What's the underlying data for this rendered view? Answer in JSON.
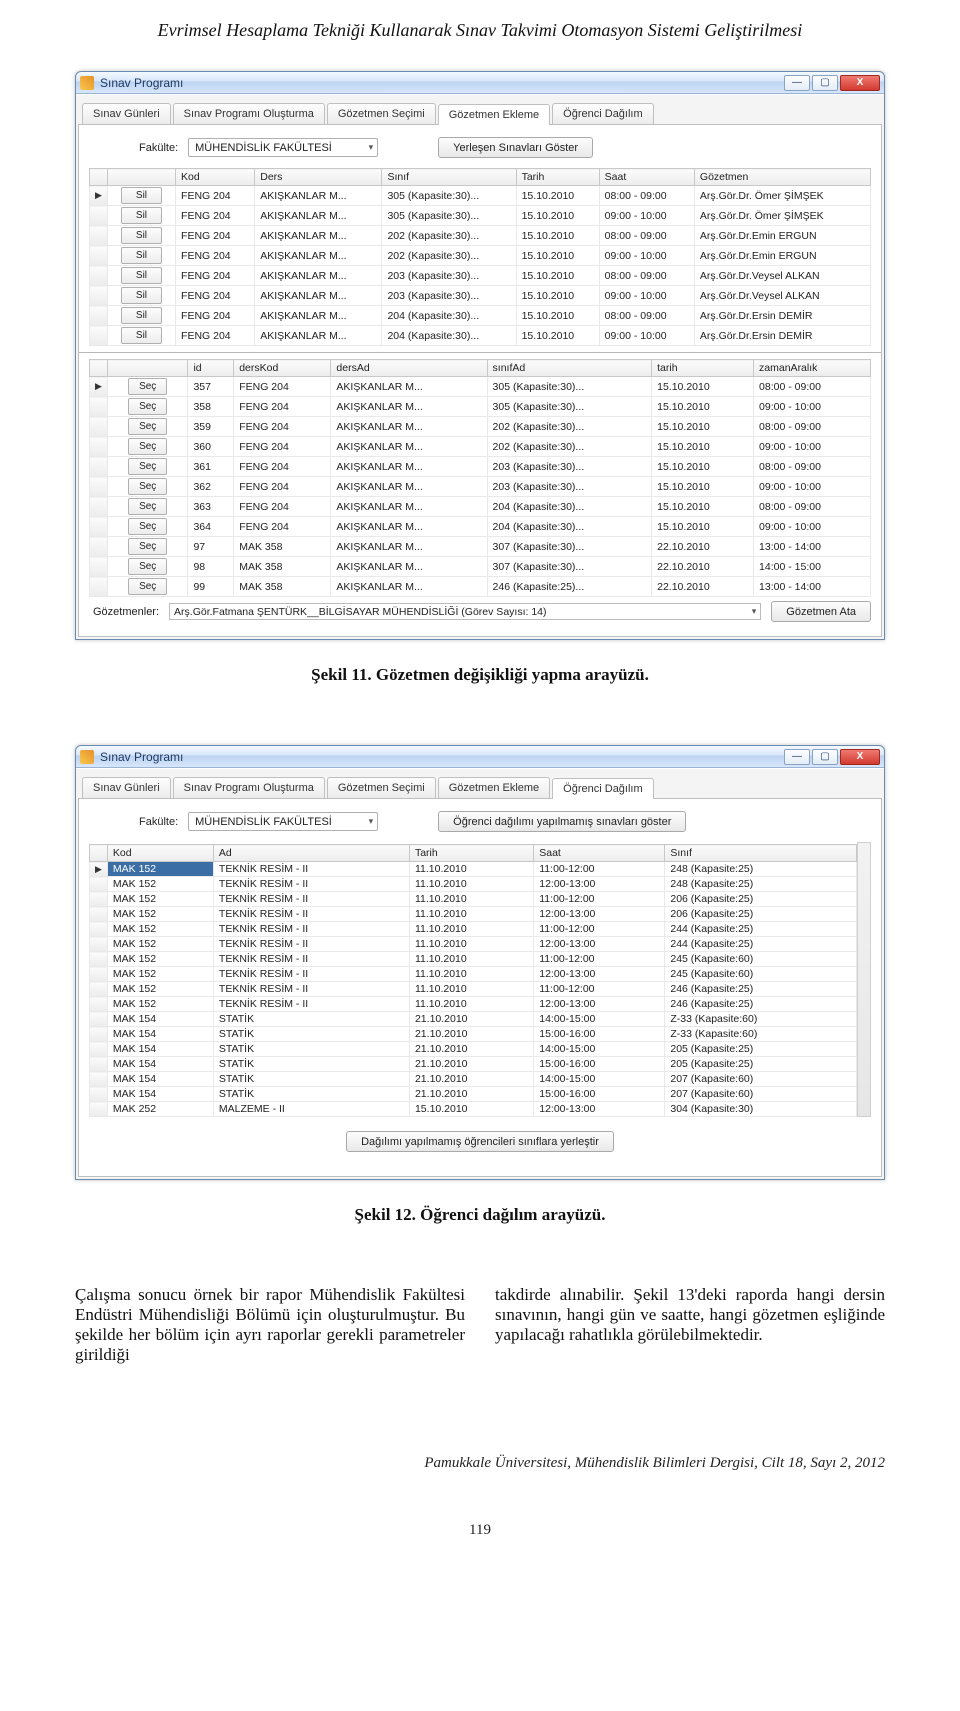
{
  "doc": {
    "header": "Evrimsel Hesaplama Tekniği Kullanarak Sınav Takvimi Otomasyon Sistemi Geliştirilmesi",
    "caption1": "Şekil 11. Gözetmen değişikliği yapma arayüzü.",
    "caption2": "Şekil 12. Öğrenci dağılım arayüzü.",
    "para_left": "Çalışma sonucu örnek bir rapor Mühendislik Fakültesi Endüstri Mühendisliği Bölümü için oluşturulmuştur. Bu şekilde her bölüm için ayrı raporlar gerekli parametreler girildiği",
    "para_right": "takdirde alınabilir. Şekil 13'deki raporda hangi dersin sınavının, hangi gün ve saatte, hangi gözetmen eşliğinde yapılacağı rahatlıkla görülebilmektedir.",
    "journal": "Pamukkale Üniversitesi, Mühendislik Bilimleri Dergisi, Cilt 18, Sayı 2, 2012",
    "page": "119"
  },
  "common": {
    "app_title": "Sınav Programı",
    "faculty_label": "Fakülte:",
    "faculty_value": "MÜHENDİSLİK FAKÜLTESİ",
    "tabs": {
      "t1": "Sınav Günleri",
      "t2": "Sınav Programı Oluşturma",
      "t3": "Gözetmen Seçimi",
      "t4": "Gözetmen Ekleme",
      "t5": "Öğrenci Dağılım"
    },
    "win_min": "—",
    "win_max": "▢",
    "win_close": "X",
    "chevron": "▾",
    "row_marker": "▶"
  },
  "fig11": {
    "btn_show_placed": "Yerleşen Sınavları Göster",
    "btn_sil": "Sil",
    "btn_sec": "Seç",
    "btn_assign": "Gözetmen Ata",
    "gozetmenler_label": "Gözetmenler:",
    "gozetmenler_value": "Arş.Gör.Fatmana ŞENTÜRK__BİLGİSAYAR MÜHENDİSLİĞİ (Görev Sayısı: 14)",
    "headers1": [
      "",
      "",
      "Kod",
      "Ders",
      "Sınıf",
      "Tarih",
      "Saat",
      "Gözetmen"
    ],
    "rows1": [
      [
        "FENG 204",
        "AKIŞKANLAR M...",
        "305 (Kapasite:30)...",
        "15.10.2010",
        "08:00 - 09:00",
        "Arş.Gör.Dr. Ömer ŞİMŞEK"
      ],
      [
        "FENG 204",
        "AKIŞKANLAR M...",
        "305 (Kapasite:30)...",
        "15.10.2010",
        "09:00 - 10:00",
        "Arş.Gör.Dr. Ömer ŞİMŞEK"
      ],
      [
        "FENG 204",
        "AKIŞKANLAR M...",
        "202 (Kapasite:30)...",
        "15.10.2010",
        "08:00 - 09:00",
        "Arş.Gör.Dr.Emin ERGUN"
      ],
      [
        "FENG 204",
        "AKIŞKANLAR M...",
        "202 (Kapasite:30)...",
        "15.10.2010",
        "09:00 - 10:00",
        "Arş.Gör.Dr.Emin ERGUN"
      ],
      [
        "FENG 204",
        "AKIŞKANLAR M...",
        "203 (Kapasite:30)...",
        "15.10.2010",
        "08:00 - 09:00",
        "Arş.Gör.Dr.Veysel ALKAN"
      ],
      [
        "FENG 204",
        "AKIŞKANLAR M...",
        "203 (Kapasite:30)...",
        "15.10.2010",
        "09:00 - 10:00",
        "Arş.Gör.Dr.Veysel ALKAN"
      ],
      [
        "FENG 204",
        "AKIŞKANLAR M...",
        "204 (Kapasite:30)...",
        "15.10.2010",
        "08:00 - 09:00",
        "Arş.Gör.Dr.Ersin DEMİR"
      ],
      [
        "FENG 204",
        "AKIŞKANLAR M...",
        "204 (Kapasite:30)...",
        "15.10.2010",
        "09:00 - 10:00",
        "Arş.Gör.Dr.Ersin DEMİR"
      ]
    ],
    "headers2": [
      "",
      "",
      "id",
      "dersKod",
      "dersAd",
      "sınıfAd",
      "tarih",
      "zamanAralık"
    ],
    "rows2": [
      [
        "357",
        "FENG 204",
        "AKIŞKANLAR M...",
        "305 (Kapasite:30)...",
        "15.10.2010",
        "08:00 - 09:00"
      ],
      [
        "358",
        "FENG 204",
        "AKIŞKANLAR M...",
        "305 (Kapasite:30)...",
        "15.10.2010",
        "09:00 - 10:00"
      ],
      [
        "359",
        "FENG 204",
        "AKIŞKANLAR M...",
        "202 (Kapasite:30)...",
        "15.10.2010",
        "08:00 - 09:00"
      ],
      [
        "360",
        "FENG 204",
        "AKIŞKANLAR M...",
        "202 (Kapasite:30)...",
        "15.10.2010",
        "09:00 - 10:00"
      ],
      [
        "361",
        "FENG 204",
        "AKIŞKANLAR M...",
        "203 (Kapasite:30)...",
        "15.10.2010",
        "08:00 - 09:00"
      ],
      [
        "362",
        "FENG 204",
        "AKIŞKANLAR M...",
        "203 (Kapasite:30)...",
        "15.10.2010",
        "09:00 - 10:00"
      ],
      [
        "363",
        "FENG 204",
        "AKIŞKANLAR M...",
        "204 (Kapasite:30)...",
        "15.10.2010",
        "08:00 - 09:00"
      ],
      [
        "364",
        "FENG 204",
        "AKIŞKANLAR M...",
        "204 (Kapasite:30)...",
        "15.10.2010",
        "09:00 - 10:00"
      ],
      [
        "97",
        "MAK 358",
        "AKIŞKANLAR M...",
        "307 (Kapasite:30)...",
        "22.10.2010",
        "13:00 - 14:00"
      ],
      [
        "98",
        "MAK 358",
        "AKIŞKANLAR M...",
        "307 (Kapasite:30)...",
        "22.10.2010",
        "14:00 - 15:00"
      ],
      [
        "99",
        "MAK 358",
        "AKIŞKANLAR M...",
        "246 (Kapasite:25)...",
        "22.10.2010",
        "13:00 - 14:00"
      ]
    ]
  },
  "fig12": {
    "btn_show_unassigned": "Öğrenci dağılımı yapılmamış sınavları göster",
    "btn_place": "Dağılımı yapılmamış öğrencileri sınıflara yerleştir",
    "headers": [
      "",
      "Kod",
      "Ad",
      "Tarih",
      "Saat",
      "Sınıf"
    ],
    "selected_kod": "MAK 152",
    "rows": [
      [
        "MAK 152",
        "TEKNİK RESİM - II",
        "11.10.2010",
        "11:00-12:00",
        "248 (Kapasite:25)"
      ],
      [
        "MAK 152",
        "TEKNİK RESİM - II",
        "11.10.2010",
        "12:00-13:00",
        "248 (Kapasite:25)"
      ],
      [
        "MAK 152",
        "TEKNİK RESİM - II",
        "11.10.2010",
        "11:00-12:00",
        "206 (Kapasite:25)"
      ],
      [
        "MAK 152",
        "TEKNİK RESİM - II",
        "11.10.2010",
        "12:00-13:00",
        "206 (Kapasite:25)"
      ],
      [
        "MAK 152",
        "TEKNİK RESİM - II",
        "11.10.2010",
        "11:00-12:00",
        "244 (Kapasite:25)"
      ],
      [
        "MAK 152",
        "TEKNİK RESİM - II",
        "11.10.2010",
        "12:00-13:00",
        "244 (Kapasite:25)"
      ],
      [
        "MAK 152",
        "TEKNİK RESİM - II",
        "11.10.2010",
        "11:00-12:00",
        "245 (Kapasite:60)"
      ],
      [
        "MAK 152",
        "TEKNİK RESİM - II",
        "11.10.2010",
        "12:00-13:00",
        "245 (Kapasite:60)"
      ],
      [
        "MAK 152",
        "TEKNİK RESİM - II",
        "11.10.2010",
        "11:00-12:00",
        "246 (Kapasite:25)"
      ],
      [
        "MAK 152",
        "TEKNİK RESİM - II",
        "11.10.2010",
        "12:00-13:00",
        "246 (Kapasite:25)"
      ],
      [
        "MAK 154",
        "STATİK",
        "21.10.2010",
        "14:00-15:00",
        "Z-33 (Kapasite:60)"
      ],
      [
        "MAK 154",
        "STATİK",
        "21.10.2010",
        "15:00-16:00",
        "Z-33 (Kapasite:60)"
      ],
      [
        "MAK 154",
        "STATİK",
        "21.10.2010",
        "14:00-15:00",
        "205 (Kapasite:25)"
      ],
      [
        "MAK 154",
        "STATİK",
        "21.10.2010",
        "15:00-16:00",
        "205 (Kapasite:25)"
      ],
      [
        "MAK 154",
        "STATİK",
        "21.10.2010",
        "14:00-15:00",
        "207 (Kapasite:60)"
      ],
      [
        "MAK 154",
        "STATİK",
        "21.10.2010",
        "15:00-16:00",
        "207 (Kapasite:60)"
      ],
      [
        "MAK 252",
        "MALZEME - II",
        "15.10.2010",
        "12:00-13:00",
        "304 (Kapasite:30)"
      ]
    ]
  }
}
